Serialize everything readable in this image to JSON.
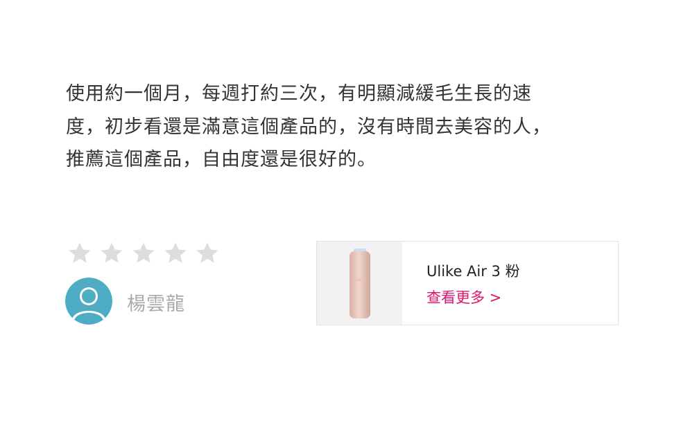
{
  "review": {
    "lines": [
      "使用約一個月，每週打約三次，有明顯減緩毛生長的速",
      "度，初步看還是滿意這個產品的，沒有時間去美容的人，",
      "推薦這個產品，自由度還是很好的。"
    ]
  },
  "rating": {
    "stars_total": 5,
    "stars_filled": 0,
    "star_color": "#dddddd"
  },
  "reviewer": {
    "name": "楊雲龍",
    "avatar_icon": "user-avatar-icon",
    "avatar_color": "#4eadc4"
  },
  "product": {
    "name": "Ulike Air 3 粉",
    "link_label": "查看更多 >",
    "link_color": "#e0136d",
    "thumbnail_icon": "hair-removal-device-image"
  }
}
